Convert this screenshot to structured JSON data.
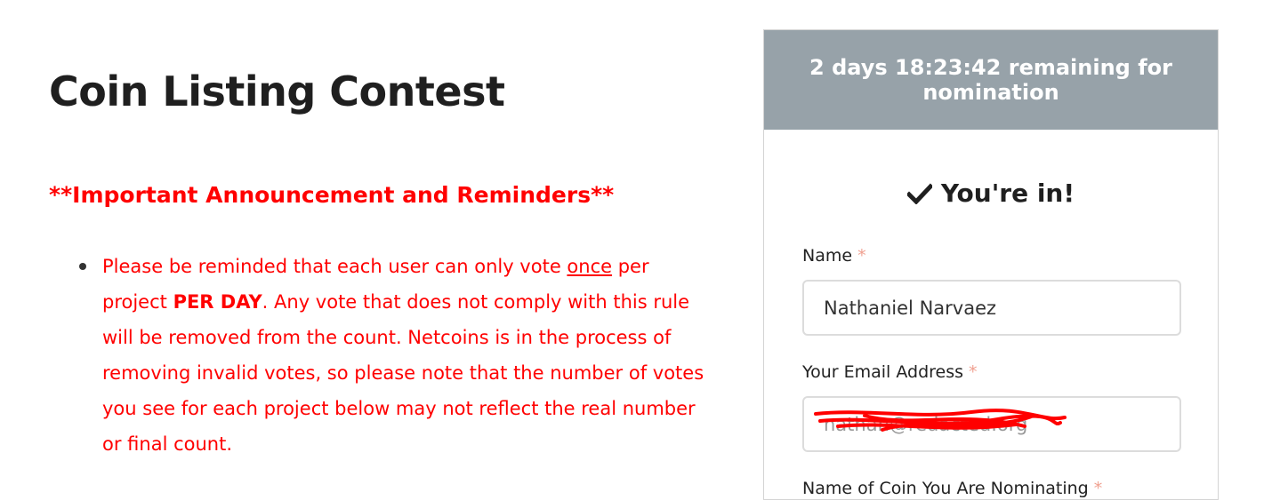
{
  "page": {
    "title": "Coin Listing Contest"
  },
  "announcement": {
    "heading": "**Important Announcement and Reminders**",
    "items": [
      {
        "part1": "Please be reminded that each user can only vote ",
        "underlined": "once",
        "part2": " per project ",
        "bold": "PER DAY",
        "part3": ".  Any vote that does not comply with this rule will be removed from the count. Netcoins is in the process of removing invalid votes, so please note that the number of votes you see for each project below may not reflect the real number or final count."
      }
    ]
  },
  "card": {
    "countdown": "2 days 18:23:42 remaining for nomination",
    "status_text": "You're in!",
    "status_icon": "check-icon",
    "fields": {
      "name": {
        "label": "Name",
        "required_mark": "*",
        "value": "Nathaniel Narvaez"
      },
      "email": {
        "label": "Your Email Address",
        "required_mark": "*",
        "value": "nathan@redacted.org"
      },
      "coin": {
        "label": "Name of Coin You Are Nominating",
        "required_mark": "*"
      }
    }
  },
  "colors": {
    "announcement": "#ff0000",
    "card_header_bg": "#97a2a9",
    "required_mark": "#f0a090",
    "redaction": "#ff0000"
  }
}
